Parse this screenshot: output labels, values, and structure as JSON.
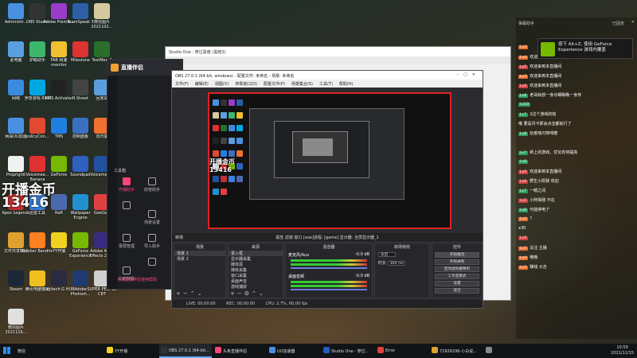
{
  "colors": {
    "obs_preview_border": "#dd2222",
    "accent_record": "#ff4477",
    "nvidia_green": "#76b900",
    "chat_level": "#2a9d5c"
  },
  "desktop": {
    "icons": [
      {
        "label": "Administr...",
        "color": "#4a90e2"
      },
      {
        "label": "OBS Studio",
        "color": "#333333"
      },
      {
        "label": "Adobe Premie...",
        "color": "#9a3cc8"
      },
      {
        "label": "TeamSpeak 3",
        "color": "#2c5fa8"
      },
      {
        "label": "微信图片 2021102...",
        "color": "#d8c8a0"
      },
      {
        "label": "此电脑",
        "color": "#5aa0e0"
      },
      {
        "label": "护眼助手",
        "color": "#3db86a"
      },
      {
        "label": "FAB 网速 monitor",
        "color": "#f0c030"
      },
      {
        "label": "Milestone",
        "color": "#d33"
      },
      {
        "label": "TestMem5",
        "color": "#2a6e2a"
      },
      {
        "label": "网络",
        "color": "#3a8ae0"
      },
      {
        "label": "罗技游戏 RME",
        "color": "#00a8e0"
      },
      {
        "label": "KMS Activator",
        "color": "#222222"
      },
      {
        "label": "R.Street",
        "color": "#444444"
      },
      {
        "label": "回收站",
        "color": "#5a9ee0"
      },
      {
        "label": "网易UU加速",
        "color": "#4a90e2"
      },
      {
        "label": "policyCon...",
        "color": "#e04a30"
      },
      {
        "label": "TMS",
        "color": "#2080e0"
      },
      {
        "label": "控制面板",
        "color": "#3a70c0"
      },
      {
        "label": "向日葵",
        "color": "#f07030"
      },
      {
        "label": "Proprighit",
        "color": "#f0f0f0"
      },
      {
        "label": "Voicemee... Banana",
        "color": "#e03030"
      },
      {
        "label": "GeForce",
        "color": "#76b900"
      },
      {
        "label": "Soundpad",
        "color": "#3060c0"
      },
      {
        "label": "Voicemee...",
        "color": "#2050a0"
      },
      {
        "label": "Apex Legends",
        "color": "#c03030"
      },
      {
        "label": "迅雷工具",
        "color": "#3a80e0"
      },
      {
        "label": "Raft",
        "color": "#4a6ab0"
      },
      {
        "label": "Wallpaper Engine",
        "color": "#2090d0"
      },
      {
        "label": "GeeGee",
        "color": "#e04040"
      },
      {
        "label": "文件共享精灵",
        "color": "#e0a030"
      },
      {
        "label": "Rubber Bandits",
        "color": "#ff8020"
      },
      {
        "label": "YY开播",
        "color": "#f0d020"
      },
      {
        "label": "GeForce Experience",
        "color": "#76b900"
      },
      {
        "label": "Adobe After Effects 2020",
        "color": "#3a2a80"
      },
      {
        "label": "Steam",
        "color": "#1b2838"
      },
      {
        "label": "腾讯电脑管家",
        "color": "#f0c020"
      },
      {
        "label": "Logitech G HUB",
        "color": "#2a2a40"
      },
      {
        "label": "Adobe Photosh...",
        "color": "#1e3a70"
      },
      {
        "label": "SUPER PEOPLE CBT",
        "color": "#d0d0d0"
      },
      {
        "label": "微信图片 2021116...",
        "color": "#e0e0e0"
      }
    ],
    "overlay_title": "开播金币",
    "overlay_value": "13416"
  },
  "background_window": {
    "title": "Studio One - 穿过黑暗 (黑暗3)"
  },
  "zhibo_app": {
    "title": "直播伴侣",
    "tools_label": "工具箱",
    "tools": [
      {
        "label": "开播助手",
        "active": true
      },
      {
        "label": "房管助手",
        "active": false
      },
      {
        "label": "",
        "active": false
      },
      {
        "label": "场景设置",
        "active": false
      },
      {
        "label": "录屏管理",
        "active": false
      },
      {
        "label": "导入助手",
        "active": false
      },
      {
        "label": "礼物特效",
        "active": false
      },
      {
        "label": "",
        "active": false
      }
    ],
    "footer": "头条直播伴侣使用帮助"
  },
  "obs": {
    "title": "OBS 27.0.1 (64-bit, windows) - 配置文件: 未命名 - 场景: 未命名",
    "menu": [
      "文件(F)",
      "编辑(E)",
      "视图(V)",
      "停靠窗口(D)",
      "配置文件(P)",
      "场景集合(S)",
      "工具(T)",
      "帮助(H)"
    ],
    "preview_overlay_title": "开播金币",
    "preview_overlay_value": "13416",
    "scene_bar_label": "转场",
    "scene_bar_center": "属性  滤镜  窗口  [exe]进程: [game] 显示器: 全屏显示器_1",
    "docks": {
      "scenes": {
        "header": "场景",
        "items": [
          "场景 1",
          "场景 2"
        ]
      },
      "sources": {
        "header": "来源",
        "items": [
          "录入框",
          "显示器采集",
          "媒体源",
          "媒体采集",
          "窗口采集",
          "桌面声音",
          "游戏捕获"
        ]
      },
      "mixer": {
        "header": "混音器",
        "channels": [
          {
            "name": "麦克风/Aux",
            "db": "-0.0 dB"
          },
          {
            "name": "桌面音频",
            "db": "-0.0 dB"
          }
        ]
      },
      "transitions": {
        "header": "转场特效",
        "type_label": "淡出",
        "duration_label": "时长",
        "duration_value": "300 ms"
      },
      "controls": {
        "header": "控件",
        "buttons": [
          "开始推流",
          "开始录制",
          "启动虚拟摄像机",
          "工作室模式",
          "设置",
          "退出"
        ],
        "active": "开始推流"
      }
    },
    "status": {
      "live": "LIVE: 00:00:00",
      "rec": "REC: 00:00:00",
      "cpu": "CPU: 2.7%, 60.00 fps"
    }
  },
  "chat": {
    "header_left": "弹幕助手",
    "header_right": "已固定",
    "notification": "按下 Alt+Z, 使用 GeForce Experience 游戏内覆盖",
    "messages": [
      {
        "badge": "Lv3",
        "badge_color": "#e87030",
        "user": "",
        "text": ""
      },
      {
        "badge": "Lv4",
        "badge_color": "#e87030",
        "user": "",
        "text": "欢迎来到本直播间"
      },
      {
        "badge": "Lv5",
        "badge_color": "#d04040",
        "user": "",
        "text": "欢迎来到本直播间"
      },
      {
        "badge": "Lv3",
        "badge_color": "#e87030",
        "user": "",
        "text": "欢迎来到本直播间"
      },
      {
        "badge": "Lv5",
        "badge_color": "#d04040",
        "user": "",
        "text": "欢迎来到本直播间"
      },
      {
        "badge": "Lv8",
        "badge_color": "#2a9d5c",
        "user": "",
        "text": "老哥就想一身仔细瞧瞧一身传"
      },
      {
        "badge": "Lv10",
        "badge_color": "#2a9d5c",
        "user": "",
        "text": ""
      },
      {
        "badge": "Lv7",
        "badge_color": "#2a9d5c",
        "user": "",
        "text": "2边个游戏的帕"
      },
      {
        "badge": "",
        "badge_color": "",
        "user": "",
        "text": "哦 要是月卡那会点击都就行了"
      },
      {
        "badge": "Lv8",
        "badge_color": "#2a9d5c",
        "user": "",
        "text": "玩者啥刃哆啡磨"
      },
      {
        "badge": "",
        "badge_color": "",
        "user": "",
        "text": ""
      },
      {
        "badge": "Lv7",
        "badge_color": "#2a9d5c",
        "user": "",
        "text": "新上的游戏、优化有待提高"
      },
      {
        "badge": "Lv8",
        "badge_color": "#2a9d5c",
        "user": "",
        "text": ""
      },
      {
        "badge": "Lv5",
        "badge_color": "#d04040",
        "user": "",
        "text": "欢迎来到本直播间"
      },
      {
        "badge": "Lv6",
        "badge_color": "#d04040",
        "user": "",
        "text": "野生小阳我 欢迎"
      },
      {
        "badge": "Lv7",
        "badge_color": "#2a9d5c",
        "user": "",
        "text": "一眼之间"
      },
      {
        "badge": "Lv5",
        "badge_color": "#d04040",
        "user": "",
        "text": "小阿得我 不在"
      },
      {
        "badge": "Lv8",
        "badge_color": "#2a9d5c",
        "user": "",
        "text": "可能停电了"
      },
      {
        "badge": "Lv4",
        "badge_color": "#e87030",
        "user": "",
        "text": "?"
      },
      {
        "badge": "",
        "badge_color": "",
        "user": "",
        "text": "x30"
      },
      {
        "badge": "Lv5",
        "badge_color": "#d04040",
        "user": "",
        "text": ""
      },
      {
        "badge": "Lv3",
        "badge_color": "#e87030",
        "user": "",
        "text": "关注 主播"
      },
      {
        "badge": "Lv4",
        "badge_color": "#e87030",
        "user": "",
        "text": "哦哦"
      },
      {
        "badge": "Lv3",
        "badge_color": "#e87030",
        "user": "",
        "text": "赚钱 大吉"
      }
    ]
  },
  "taskbar": {
    "search": "微信",
    "items": [
      {
        "label": "YY开播",
        "color": "#f0d020"
      },
      {
        "label": "OBS 27.0.1 (64-bit...",
        "color": "#333333",
        "active": true
      },
      {
        "label": "头条直播伴侣",
        "color": "#f47"
      },
      {
        "label": "UU加速器",
        "color": "#4a90e2"
      },
      {
        "label": "Studio One - 穿过...",
        "color": "#2060c0"
      },
      {
        "label": "Error",
        "color": "#e04040"
      },
      {
        "label": "72926296-小白说...",
        "color": "#e0a030"
      },
      {
        "label": "",
        "color": "#888888"
      }
    ],
    "time": "10:59",
    "date": "2021/12/15"
  }
}
